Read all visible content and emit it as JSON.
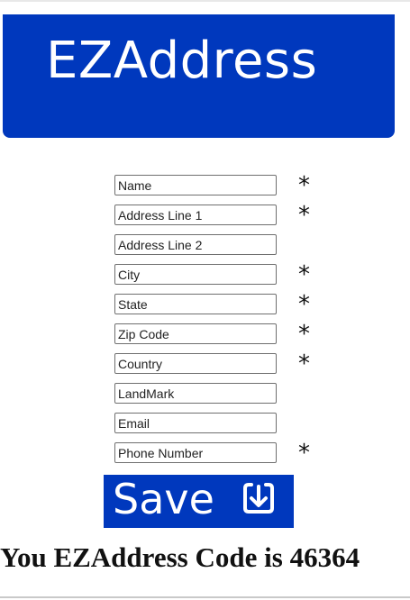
{
  "header": {
    "title": "EZAddress"
  },
  "form": {
    "fields": [
      {
        "placeholder": "Name",
        "required": true
      },
      {
        "placeholder": "Address Line 1",
        "required": true
      },
      {
        "placeholder": "Address Line 2",
        "required": false
      },
      {
        "placeholder": "City",
        "required": true
      },
      {
        "placeholder": "State",
        "required": true
      },
      {
        "placeholder": "Zip Code",
        "required": true
      },
      {
        "placeholder": "Country",
        "required": true
      },
      {
        "placeholder": "LandMark",
        "required": false
      },
      {
        "placeholder": "Email",
        "required": false
      },
      {
        "placeholder": "Phone Number",
        "required": true
      }
    ],
    "required_marker": "*",
    "save_label": "Save",
    "save_icon": "download-arrow-icon"
  },
  "result": {
    "message": "You EZAddress Code is 46364"
  },
  "colors": {
    "brand_blue": "#0038bd",
    "text": "#111111",
    "field_border": "#6f6f6f"
  }
}
